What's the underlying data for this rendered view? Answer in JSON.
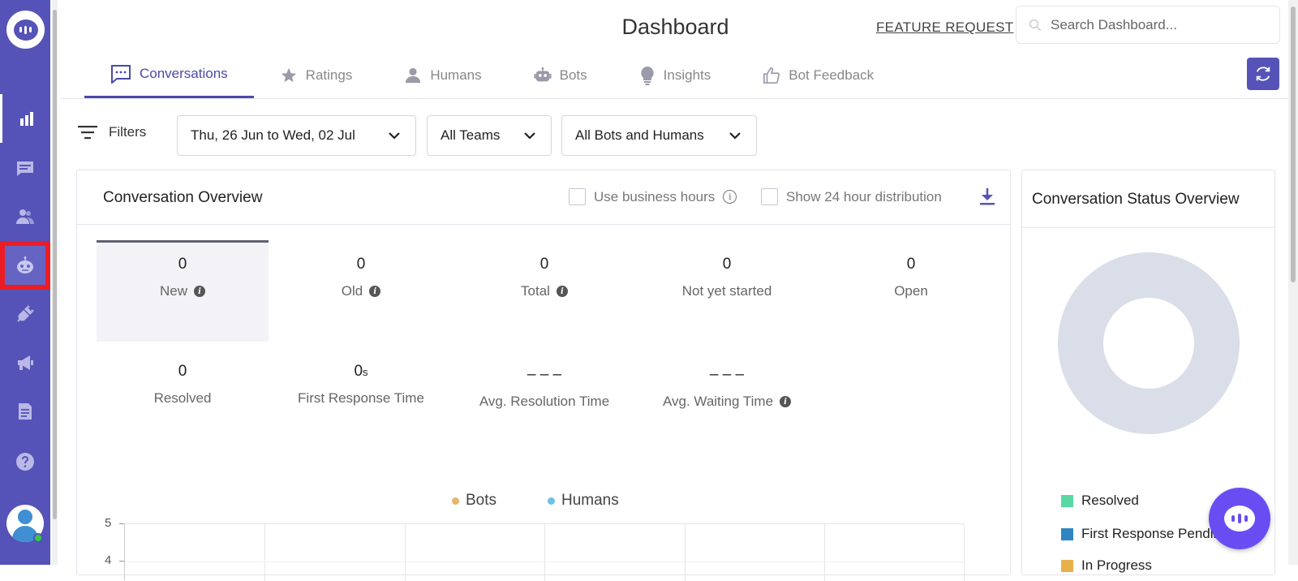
{
  "sidebar": {
    "items": [
      {
        "name": "analytics",
        "icon": "bar-chart-icon"
      },
      {
        "name": "conversations",
        "icon": "message-icon"
      },
      {
        "name": "contacts",
        "icon": "users-icon"
      },
      {
        "name": "bots",
        "icon": "bot-icon"
      },
      {
        "name": "integrations",
        "icon": "plug-icon"
      },
      {
        "name": "campaigns",
        "icon": "megaphone-icon"
      },
      {
        "name": "reports",
        "icon": "document-icon"
      },
      {
        "name": "help",
        "icon": "question-icon"
      }
    ]
  },
  "header": {
    "title": "Dashboard",
    "feature_request": "FEATURE REQUEST",
    "search_placeholder": "Search Dashboard..."
  },
  "tabs": [
    {
      "label": "Conversations",
      "icon": "chat-icon"
    },
    {
      "label": "Ratings",
      "icon": "star-icon"
    },
    {
      "label": "Humans",
      "icon": "person-icon"
    },
    {
      "label": "Bots",
      "icon": "robot-icon"
    },
    {
      "label": "Insights",
      "icon": "lightbulb-icon"
    },
    {
      "label": "Bot Feedback",
      "icon": "thumbs-up-icon"
    }
  ],
  "filters": {
    "label": "Filters",
    "date_from": "Thu, 26 Jun",
    "date_to_word": "to",
    "date_to": "Wed, 02 Jul",
    "teams": "All Teams",
    "agents": "All Bots and Humans"
  },
  "overview": {
    "title": "Conversation Overview",
    "business_hours": "Use business hours",
    "distribution": "Show 24 hour distribution",
    "metrics": [
      {
        "value": "0",
        "label": "New"
      },
      {
        "value": "0",
        "label": "Old"
      },
      {
        "value": "0",
        "label": "Total"
      },
      {
        "value": "0",
        "label": "Not yet started"
      },
      {
        "value": "0",
        "label": "Open"
      },
      {
        "value": "0",
        "label": "Resolved"
      },
      {
        "value": "0",
        "unit": "s",
        "label": "First Response Time"
      },
      {
        "value": "– – –",
        "label": "Avg. Resolution Time"
      },
      {
        "value": "– – –",
        "label": "Avg. Waiting Time"
      }
    ],
    "legend": [
      {
        "name": "Bots",
        "color": "#e3b66c"
      },
      {
        "name": "Humans",
        "color": "#6ec1ea"
      }
    ],
    "y_ticks": [
      "5",
      "4"
    ]
  },
  "status": {
    "title": "Conversation Status Overview",
    "legend": [
      {
        "name": "Resolved",
        "color": "#58d8a3"
      },
      {
        "name": "First Response Pending",
        "color": "#2e86c1"
      },
      {
        "name": "In Progress",
        "color": "#e8b04b"
      }
    ],
    "donut_color": "#d9dee9"
  },
  "colors": {
    "brand": "#5553b7",
    "accent": "#4b49a8",
    "fab": "#6a4df2"
  }
}
